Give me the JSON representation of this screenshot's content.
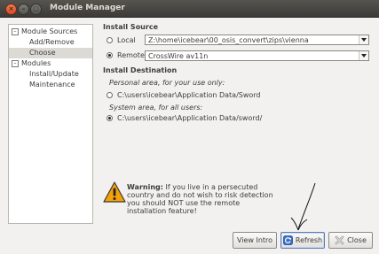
{
  "window": {
    "title": "Module Manager",
    "controls": {
      "close": "×",
      "minimize": "–",
      "maximize": "□"
    }
  },
  "tree": {
    "items": [
      {
        "label": "Module Sources",
        "expander": "–",
        "level": 0
      },
      {
        "label": "Add/Remove",
        "level": 1
      },
      {
        "label": "Choose",
        "level": 1,
        "selected": true
      },
      {
        "label": "Modules",
        "expander": "–",
        "level": 0
      },
      {
        "label": "Install/Update",
        "level": 1
      },
      {
        "label": "Maintenance",
        "level": 1
      }
    ]
  },
  "install_source": {
    "heading": "Install Source",
    "local_label": "Local",
    "local_path": "Z:\\home\\icebear\\00_osis_convert\\zips\\vienna",
    "remote_label": "Remote",
    "remote_value": "CrossWire av11n",
    "selected": "remote"
  },
  "install_destination": {
    "heading": "Install Destination",
    "personal_caption": "Personal area, for your use only:",
    "personal_path": "C:\\users\\icebear\\Application Data/Sword",
    "system_caption": "System area, for all users:",
    "system_path": "C:\\users\\icebear\\Application Data/sword/",
    "selected": "system"
  },
  "warning": {
    "bold": "Warning:",
    "text": " If you live in a persecuted country and do not wish to risk detection you should NOT use the remote installation feature!"
  },
  "buttons": {
    "view_intro": "View Intro",
    "refresh": "Refresh",
    "close": "Close"
  },
  "colors": {
    "titlebar": "#3c3b37",
    "close_button": "#e05a2b",
    "warning_fill": "#f5a20a",
    "refresh_icon": "#3b6ec6",
    "close_icon": "#c8c8c8"
  }
}
